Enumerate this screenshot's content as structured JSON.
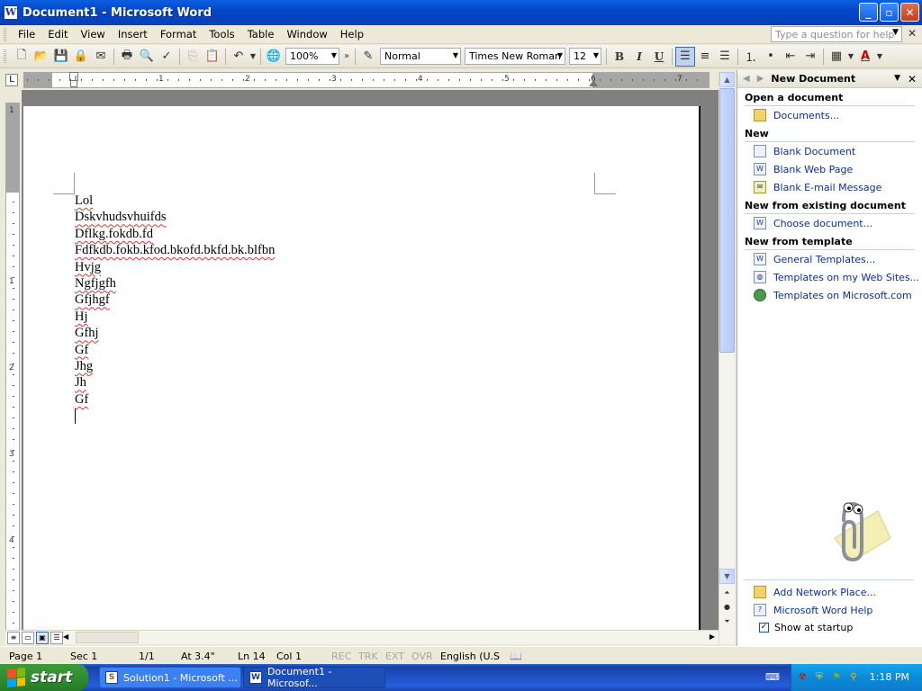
{
  "window": {
    "title": "Document1 - Microsoft Word",
    "app_icon_letter": "W",
    "buttons": {
      "minimize": "_",
      "maximize": "▫",
      "close": "✕"
    }
  },
  "menu": {
    "items": [
      "File",
      "Edit",
      "View",
      "Insert",
      "Format",
      "Tools",
      "Table",
      "Window",
      "Help"
    ],
    "help_placeholder": "Type a question for help"
  },
  "toolbar": {
    "zoom": "100%",
    "style": "Normal",
    "font": "Times New Roman",
    "size": "12",
    "bold": "B",
    "italic": "I",
    "underline": "U",
    "font_color": "A"
  },
  "ruler": {
    "numbers": [
      "1",
      "1",
      "2",
      "3",
      "4",
      "5",
      "6",
      "7"
    ],
    "vertical_numbers": [
      "1",
      "1",
      "2",
      "3",
      "4"
    ],
    "corner": "L"
  },
  "document": {
    "lines": [
      "Lol",
      "Dskvhudsvhuifds",
      "Dflkg.fokdb.fd",
      "Fdfkdb.fokb.kfod.bkofd.bkfd.bk.blfbn",
      "Hvjg",
      "Ngfjgfh",
      "Gfjhgf",
      "Hj",
      "Gfhj",
      "Gf",
      "Jhg",
      "Jh",
      "Gf"
    ],
    "spell_underline_color": "#e33333"
  },
  "task_pane": {
    "title": "New Document",
    "sections": [
      {
        "heading": "Open a document",
        "links": [
          {
            "label": "Documents...",
            "icon": "folder-icon"
          }
        ]
      },
      {
        "heading": "New",
        "links": [
          {
            "label": "Blank Document",
            "icon": "document-icon"
          },
          {
            "label": "Blank Web Page",
            "icon": "web-page-icon"
          },
          {
            "label": "Blank E-mail Message",
            "icon": "email-icon"
          }
        ]
      },
      {
        "heading": "New from existing document",
        "links": [
          {
            "label": "Choose document...",
            "icon": "document-icon"
          }
        ]
      },
      {
        "heading": "New from template",
        "links": [
          {
            "label": "General Templates...",
            "icon": "template-icon"
          },
          {
            "label": "Templates on my Web Sites...",
            "icon": "web-templates-icon"
          },
          {
            "label": "Templates on Microsoft.com",
            "icon": "globe-icon"
          }
        ]
      }
    ],
    "bottom_links": [
      {
        "label": "Add Network Place...",
        "icon": "network-folder-icon"
      },
      {
        "label": "Microsoft Word Help",
        "icon": "help-icon"
      }
    ],
    "show_at_startup": "Show at startup"
  },
  "status": {
    "page": "Page  1",
    "sec": "Sec  1",
    "pages": "1/1",
    "at": "At  3.4\"",
    "ln": "Ln  14",
    "col": "Col  1",
    "rec": "REC",
    "trk": "TRK",
    "ext": "EXT",
    "ovr": "OVR",
    "language": "English (U.S"
  },
  "taskbar": {
    "start": "start",
    "items": [
      {
        "label": "Solution1 - Microsoft ...",
        "icon": "S"
      },
      {
        "label": "Document1 - Microsof...",
        "icon": "W"
      }
    ],
    "clock": "1:18 PM"
  }
}
